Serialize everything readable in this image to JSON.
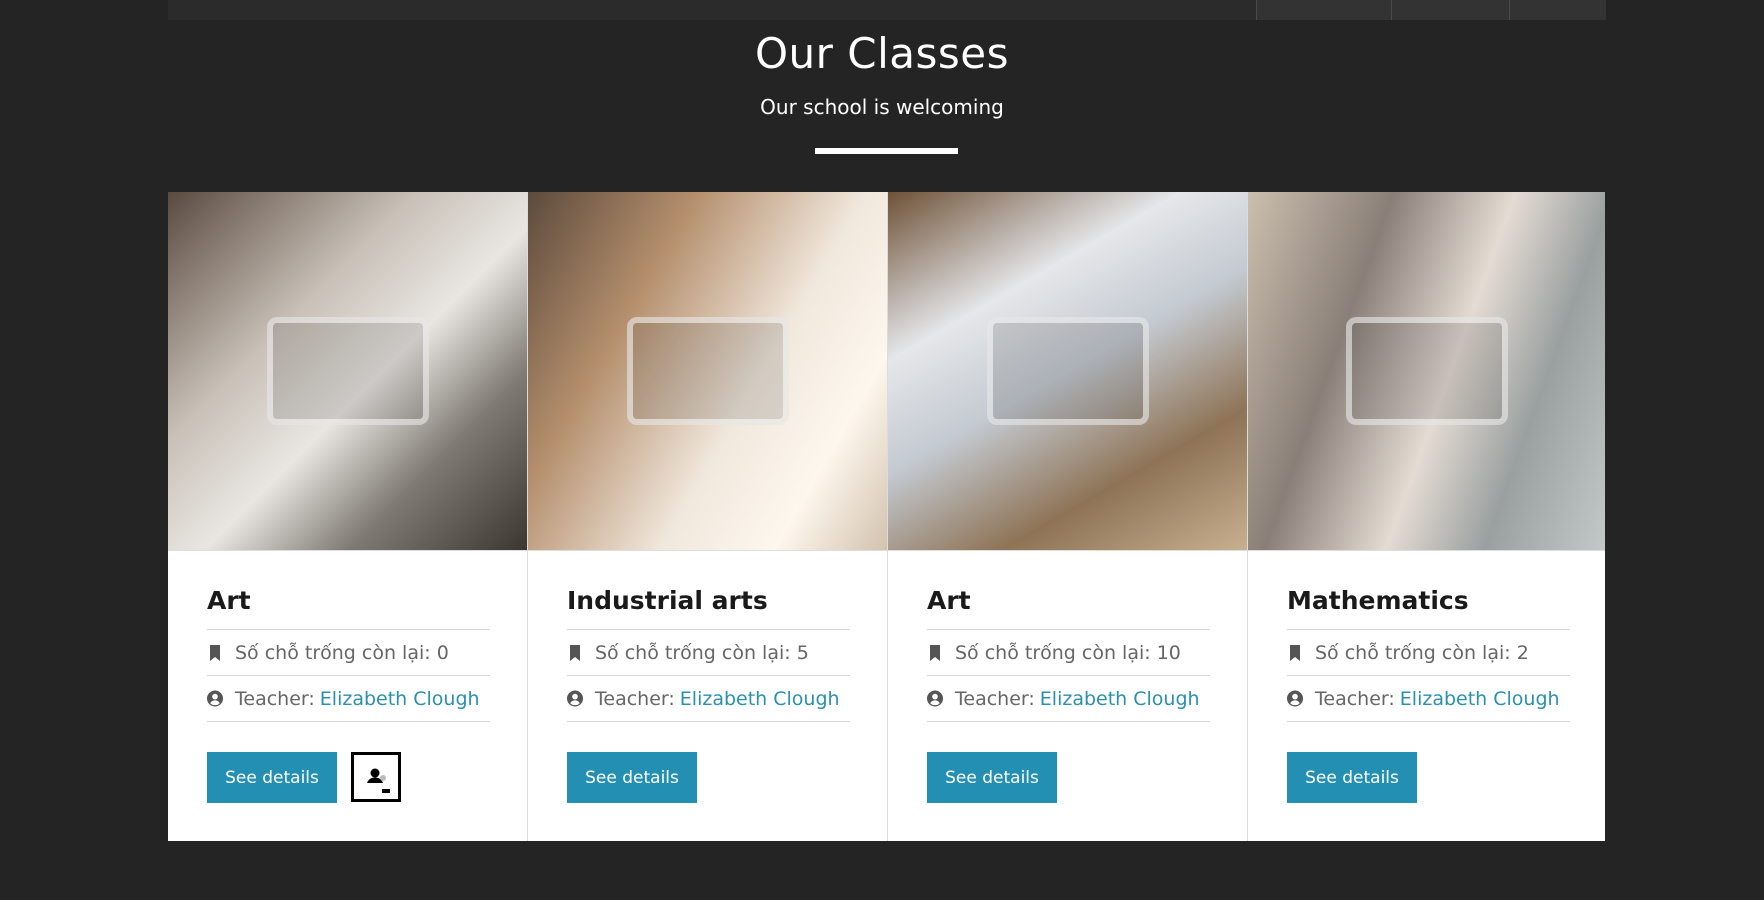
{
  "header": {
    "title": "Our Classes",
    "subtitle": "Our school is welcoming"
  },
  "colors": {
    "background": "#242424",
    "accent": "#238fb3",
    "link": "#2a90b0"
  },
  "icons": {
    "seats": "bookmark-icon",
    "teacher": "user-circle-icon",
    "widget": "person-badge-icon"
  },
  "classes": [
    {
      "title": "Art",
      "seats_text": "Số chỗ trống còn lại: 0",
      "teacher_label": "Teacher:",
      "teacher_name": "Elizabeth Clough",
      "button_label": "See details"
    },
    {
      "title": "Industrial arts",
      "seats_text": "Số chỗ trống còn lại: 5",
      "teacher_label": "Teacher:",
      "teacher_name": "Elizabeth Clough",
      "button_label": "See details"
    },
    {
      "title": "Art",
      "seats_text": "Số chỗ trống còn lại: 10",
      "teacher_label": "Teacher:",
      "teacher_name": "Elizabeth Clough",
      "button_label": "See details"
    },
    {
      "title": "Mathematics",
      "seats_text": "Số chỗ trống còn lại: 2",
      "teacher_label": "Teacher:",
      "teacher_name": "Elizabeth Clough",
      "button_label": "See details"
    }
  ]
}
